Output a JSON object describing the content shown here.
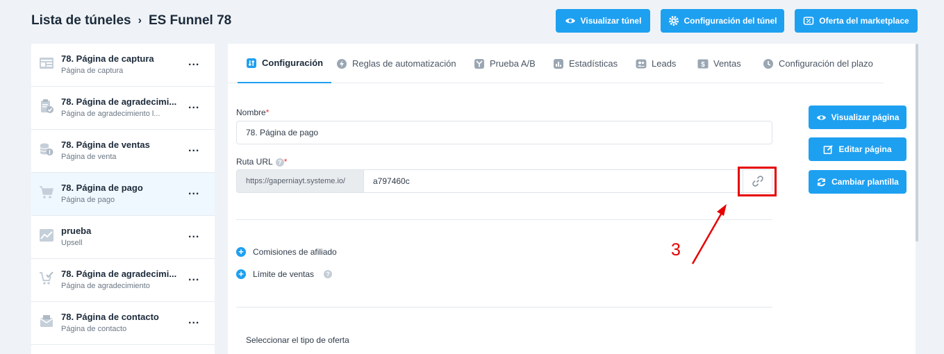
{
  "breadcrumb": {
    "parent": "Lista de túneles",
    "separator": "›",
    "current": "ES Funnel 78"
  },
  "top_buttons": {
    "preview_funnel": "Visualizar túnel",
    "funnel_settings": "Configuración del túnel",
    "marketplace_offer": "Oferta del marketplace"
  },
  "sidebar": {
    "steps": [
      {
        "title": "78. Página de captura",
        "subtitle": "Página de captura",
        "icon": "squeeze-page-icon"
      },
      {
        "title": "78. Página de agradecimi...",
        "subtitle": "Página de agradecimiento l...",
        "icon": "clipboard-check-icon"
      },
      {
        "title": "78. Página de ventas",
        "subtitle": "Página de venta",
        "icon": "coins-icon"
      },
      {
        "title": "78. Página de pago",
        "subtitle": "Página de pago",
        "icon": "cart-icon"
      },
      {
        "title": "prueba",
        "subtitle": "Upsell",
        "icon": "chart-up-icon"
      },
      {
        "title": "78. Página de agradecimi...",
        "subtitle": "Página de agradecimiento",
        "icon": "cart-check-icon"
      },
      {
        "title": "78. Página de contacto",
        "subtitle": "Página de contacto",
        "icon": "envelope-icon"
      }
    ],
    "more": "..."
  },
  "tabs": [
    "Configuración",
    "Reglas de automatización",
    "Prueba A/B",
    "Estadísticas",
    "Leads",
    "Ventas",
    "Configuración del plazo"
  ],
  "form": {
    "name_label": "Nombre",
    "required_mark": "*",
    "name_value": "78. Página de pago",
    "url_label": "Ruta URL",
    "help_mark": "?",
    "url_prefix": "https://gaperniayt.systeme.io/",
    "url_value": "a797460c",
    "affiliate_commissions": "Comisiones de afiliado",
    "sales_limit": "Límite de ventas",
    "offer_type": "Seleccionar el tipo de oferta"
  },
  "side_buttons": {
    "preview_page": "Visualizar página",
    "edit_page": "Editar página",
    "change_template": "Cambiar plantilla"
  },
  "annotation": {
    "number": "3"
  },
  "colors": {
    "accent": "#1ea0f1",
    "annotation": "#e60000",
    "background": "#eff3f7"
  }
}
